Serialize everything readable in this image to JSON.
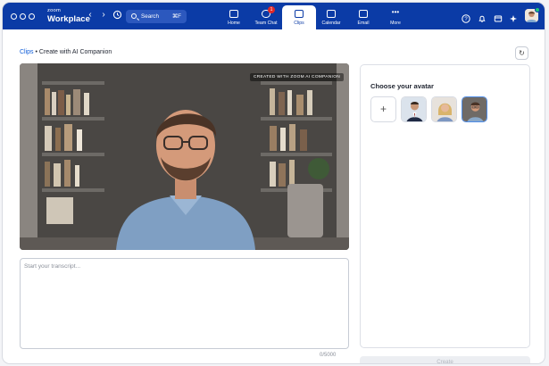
{
  "app": {
    "logo_small": "zoom",
    "logo_big": "Workplace",
    "search": {
      "label": "Search",
      "shortcut": "⌘F"
    }
  },
  "tabs": [
    {
      "label": "Home",
      "icon": "home-icon"
    },
    {
      "label": "Team Chat",
      "icon": "chat-icon",
      "badge": "1"
    },
    {
      "label": "Clips",
      "icon": "clips-icon",
      "active": true
    },
    {
      "label": "Calendar",
      "icon": "calendar-icon"
    },
    {
      "label": "Email",
      "icon": "email-icon"
    },
    {
      "label": "More",
      "icon": "more-icon"
    }
  ],
  "breadcrumb": {
    "link": "Clips",
    "separator": "•",
    "current": "Create with AI Companion"
  },
  "video": {
    "watermark": "CREATED WITH ZOOM AI COMPANION"
  },
  "transcript": {
    "placeholder": "Start your transcript...",
    "counter": "0/5000"
  },
  "avatar_panel": {
    "title": "Choose your avatar",
    "avatars": [
      {
        "name": "man-in-suit"
      },
      {
        "name": "blonde-woman"
      },
      {
        "name": "man-with-glasses",
        "selected": true
      }
    ]
  },
  "create_button": "Create",
  "colors": {
    "topbar": "#0b3ba6",
    "link": "#0e5cd8",
    "selected_border": "#4f8de8"
  }
}
